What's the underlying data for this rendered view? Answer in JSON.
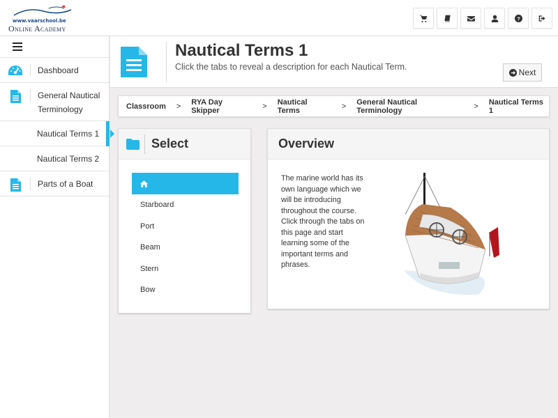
{
  "logo": {
    "url": "www.vaarschool.be",
    "name": "Online Academy"
  },
  "topbar": {
    "icons": [
      "cart-icon",
      "book-icon",
      "envelope-icon",
      "user-icon",
      "question-icon",
      "sign-out-icon"
    ]
  },
  "sidebar": {
    "items": [
      {
        "label": "Dashboard",
        "icon": "dashboard-icon"
      },
      {
        "label": "General Nautical Terminology",
        "icon": "document-icon"
      },
      {
        "label": "Nautical Terms 1",
        "active": true
      },
      {
        "label": "Nautical Terms 2"
      },
      {
        "label": "Parts of a Boat",
        "icon": "document-icon"
      }
    ]
  },
  "header": {
    "title": "Nautical Terms 1",
    "subtitle": "Click the tabs to reveal a description for each Nautical Term.",
    "next_label": "Next"
  },
  "breadcrumb": [
    "Classroom",
    "RYA Day Skipper",
    "Nautical Terms",
    "General Nautical Terminology",
    "Nautical Terms 1"
  ],
  "breadcrumb_sep": ">",
  "select_panel": {
    "title": "Select",
    "tabs": [
      "Starboard",
      "Port",
      "Beam",
      "Stern",
      "Bow"
    ]
  },
  "overview": {
    "title": "Overview",
    "text": "The marine world has its own language which we will be introducing throughout the course. Click through the tabs on this page and start learning some of the important terms and phrases."
  },
  "colors": {
    "accent": "#26b7e9",
    "background": "#efeded"
  }
}
